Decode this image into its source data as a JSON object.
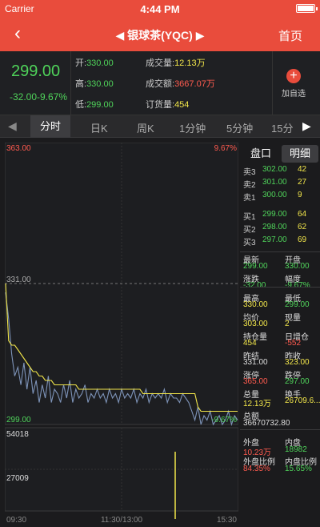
{
  "status": {
    "carrier": "Carrier",
    "time": "4:44 PM"
  },
  "nav": {
    "title": "银球茶(YQC)",
    "home": "首页"
  },
  "quote": {
    "price": "299.00",
    "change": "-32.00-9.67%",
    "open_label": "开:",
    "open": "330.00",
    "high_label": "高:",
    "high": "330.00",
    "low_label": "低:",
    "low": "299.00",
    "volume_label": "成交量:",
    "volume": "12.13万",
    "amount_label": "成交额:",
    "amount": "3667.07万",
    "order_label": "订货量:",
    "order": "454",
    "add_label": "加自选"
  },
  "tabs": [
    "分时",
    "日K",
    "周K",
    "1分钟",
    "5分钟",
    "15分"
  ],
  "chart_labels": {
    "top": "363.00",
    "top_pct": "9.67%",
    "mid": "331.00",
    "bottom": "299.00",
    "bottom_pct": "-9.67%",
    "vol_top": "54018",
    "vol_mid": "27009",
    "time_start": "09:30",
    "time_mid": "11:30/13:00",
    "time_end": "15:30"
  },
  "chart_data": {
    "type": "line",
    "ylim": [
      299,
      363
    ],
    "reference": 331,
    "series": [
      {
        "values": [
          329,
          323,
          315,
          310,
          312,
          308,
          313,
          307,
          312,
          306,
          309,
          304,
          308,
          305,
          310,
          304,
          307,
          306,
          304,
          308,
          305,
          309,
          304,
          307,
          305,
          306,
          308,
          304,
          306,
          305,
          307,
          305,
          306,
          304,
          307,
          305,
          306,
          304,
          307,
          305,
          306,
          305,
          307,
          304,
          306,
          305,
          307,
          304,
          306,
          305,
          306,
          305,
          307,
          304,
          306,
          305,
          305,
          304,
          306,
          305,
          304,
          302,
          300,
          303,
          299,
          301,
          300,
          302,
          299,
          300,
          301,
          299,
          300,
          302,
          299,
          301,
          300
        ]
      },
      {
        "values": [
          331,
          318,
          317,
          317,
          316,
          315,
          314,
          313,
          312,
          311,
          311,
          310,
          310,
          309,
          309,
          309,
          308,
          308,
          308,
          308,
          308,
          308,
          308,
          308,
          307,
          307,
          307,
          307,
          307,
          307,
          307,
          307,
          307,
          307,
          307,
          307,
          307,
          307,
          307,
          307,
          307,
          307,
          307,
          307,
          307,
          306,
          306,
          306,
          306,
          306,
          306,
          306,
          306,
          306,
          306,
          306,
          306,
          306,
          306,
          306,
          306,
          306,
          306,
          303,
          302,
          302,
          302,
          302,
          302,
          302,
          302,
          302,
          302,
          302,
          302,
          302,
          302
        ]
      }
    ]
  },
  "side": {
    "tab_book": "盘口",
    "tab_detail": "明细",
    "asks": [
      {
        "label": "卖3",
        "price": "302.00",
        "qty": "42"
      },
      {
        "label": "卖2",
        "price": "301.00",
        "qty": "27"
      },
      {
        "label": "卖1",
        "price": "300.00",
        "qty": "9"
      }
    ],
    "bids": [
      {
        "label": "买1",
        "price": "299.00",
        "qty": "64"
      },
      {
        "label": "买2",
        "price": "298.00",
        "qty": "62"
      },
      {
        "label": "买3",
        "price": "297.00",
        "qty": "69"
      }
    ],
    "stats": [
      [
        "最新",
        "299.00",
        "开盘",
        "330.00"
      ],
      [
        "涨跌",
        "-32.00",
        "幅度",
        "-9.67%"
      ],
      [
        "最高",
        "330.00",
        "最低",
        "299.00"
      ],
      [
        "均价",
        "303.00",
        "现量",
        "2"
      ],
      [
        "持仓量",
        "454",
        "日增仓",
        "-552"
      ],
      [
        "昨结",
        "331.00",
        "昨收",
        "323.00"
      ],
      [
        "涨停",
        "365.00",
        "跌停",
        "297.00"
      ],
      [
        "总量",
        "12.13万",
        "换手",
        "26709.6..."
      ]
    ],
    "total_label": "总额",
    "total": "36670732.80",
    "outer_label": "外盘",
    "outer": "10.23万",
    "inner_label": "内盘",
    "inner": "18982",
    "outer_ratio_label": "外盘比例",
    "outer_ratio": "84.35%",
    "inner_ratio_label": "内盘比例",
    "inner_ratio": "15.65%"
  }
}
